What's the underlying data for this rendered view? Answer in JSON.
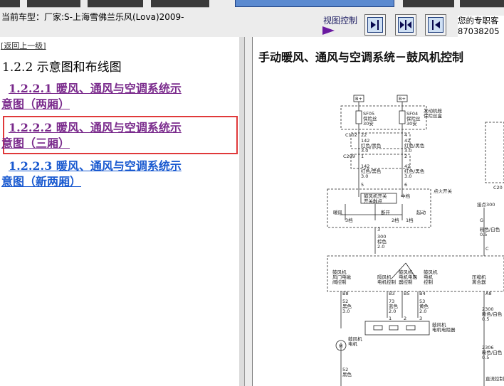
{
  "header": {
    "vehicle_label": "当前车型：厂家:S-上海雪佛兰乐风(Lova)2009-",
    "view_control_label": "视图控制",
    "user_info_line1": "您的专职客",
    "user_info_line2": "87038205"
  },
  "left_pane": {
    "back_link": "[返回上一级]",
    "section_heading": "1.2.2 示意图和布线图",
    "toc_items": [
      {
        "line1": "1.2.2.1 暖风、通风与空调系统示",
        "line2": "意图（两厢）"
      },
      {
        "line1": "1.2.2.2 暖风、通风与空调系统示",
        "line2": "意图（三厢）"
      },
      {
        "line1": "1.2.2.3 暖风、通风与空调系统示",
        "line2": "意图（新两厢）"
      }
    ]
  },
  "right_pane": {
    "doc_title": "手动暖风、通风与空调系统－鼓风机控制",
    "diagram": {
      "bplus": "B+",
      "fuse_sf05": "SF05",
      "fuse_sf04": "SF04",
      "fuse_sub": "保险丝",
      "fuse_amp": "30安",
      "engine_box_1": "发动机舱",
      "engine_box_2": "保险丝盒",
      "conn_c102": "C102",
      "conn_c209": "C209",
      "c20": "C20",
      "pin_22": "22",
      "pin_4": "4",
      "pin_1": "1",
      "pin_2": "2",
      "pin_5": "5",
      "pin_6": "6",
      "pin_3": "3",
      "pin_11": "11",
      "pin_12": "12",
      "wire_142": "142",
      "wire_42": "42",
      "wire_red_white": "红色/黑色",
      "wire_red_white2": "红色/黑色",
      "wire_30": "3.0",
      "ignition_switch": "点火开关",
      "blower_relay_1": "鼓风机开关",
      "blower_relay_2": "中档",
      "blower_relay_3": "开关触点",
      "pos_off": "断开",
      "pos_warm": "暖风",
      "pos_crank": "起动",
      "pos_1": "1档",
      "pos_2": "2档",
      "pos_3": "3档",
      "wire_300": "300",
      "wire_brown": "棕色",
      "wire_20": "2.0",
      "plus_wire": "接点300",
      "side_conn_g": "G",
      "wire_pink_1": "粉色/白色",
      "wire_05": "0.5",
      "wire_c": "C",
      "blower_motor_ctrl_1": "鼓风机",
      "blower_motor_ctrl_2": "风门电磁",
      "blower_motor_ctrl_3": "阀控制",
      "dry_res_1": "隔风机",
      "dry_res_2": "电机控制",
      "blower_res_1": "鼓风机",
      "blower_res_2": "电机电阻",
      "blower_res_3": "器控制",
      "blower_res2_1": "鼓风机",
      "blower_res2_2": "电机",
      "blower_res2_3": "控制",
      "ac_comp_1": "压缩机",
      "ac_comp_2": "离合器",
      "pin_b8": "B8",
      "pin_b3": "B3",
      "pin_b5": "B5",
      "pin_b4": "B4",
      "pin_a8": "A8",
      "wire_52": "52",
      "wire_52b": "52",
      "wire_53": "53",
      "wire_blue": "蓝色",
      "wire_73": "73",
      "wire_yellow": "黄色",
      "wire_black": "黑色",
      "wire_2300": "2300",
      "wire_2306": "2306",
      "res_caption_1": "鼓风机",
      "res_caption_2": "电机电阻器",
      "motor_m": "M",
      "motor_label_1": "鼓风机",
      "motor_label_2": "电机",
      "bottom_ctrl": "直流控制"
    }
  },
  "colors": {
    "top_bg": "#ececec",
    "link_purple": "#7a2a8c",
    "link_blue": "#1a5ad0",
    "highlight_red": "#e0393a",
    "arrow_purple": "#6a1aa0"
  },
  "icons": {
    "view_left": "collapse-left-icon",
    "view_both": "split-view-icon",
    "view_right": "collapse-right-icon",
    "view_arrow": "play-arrow-icon"
  }
}
